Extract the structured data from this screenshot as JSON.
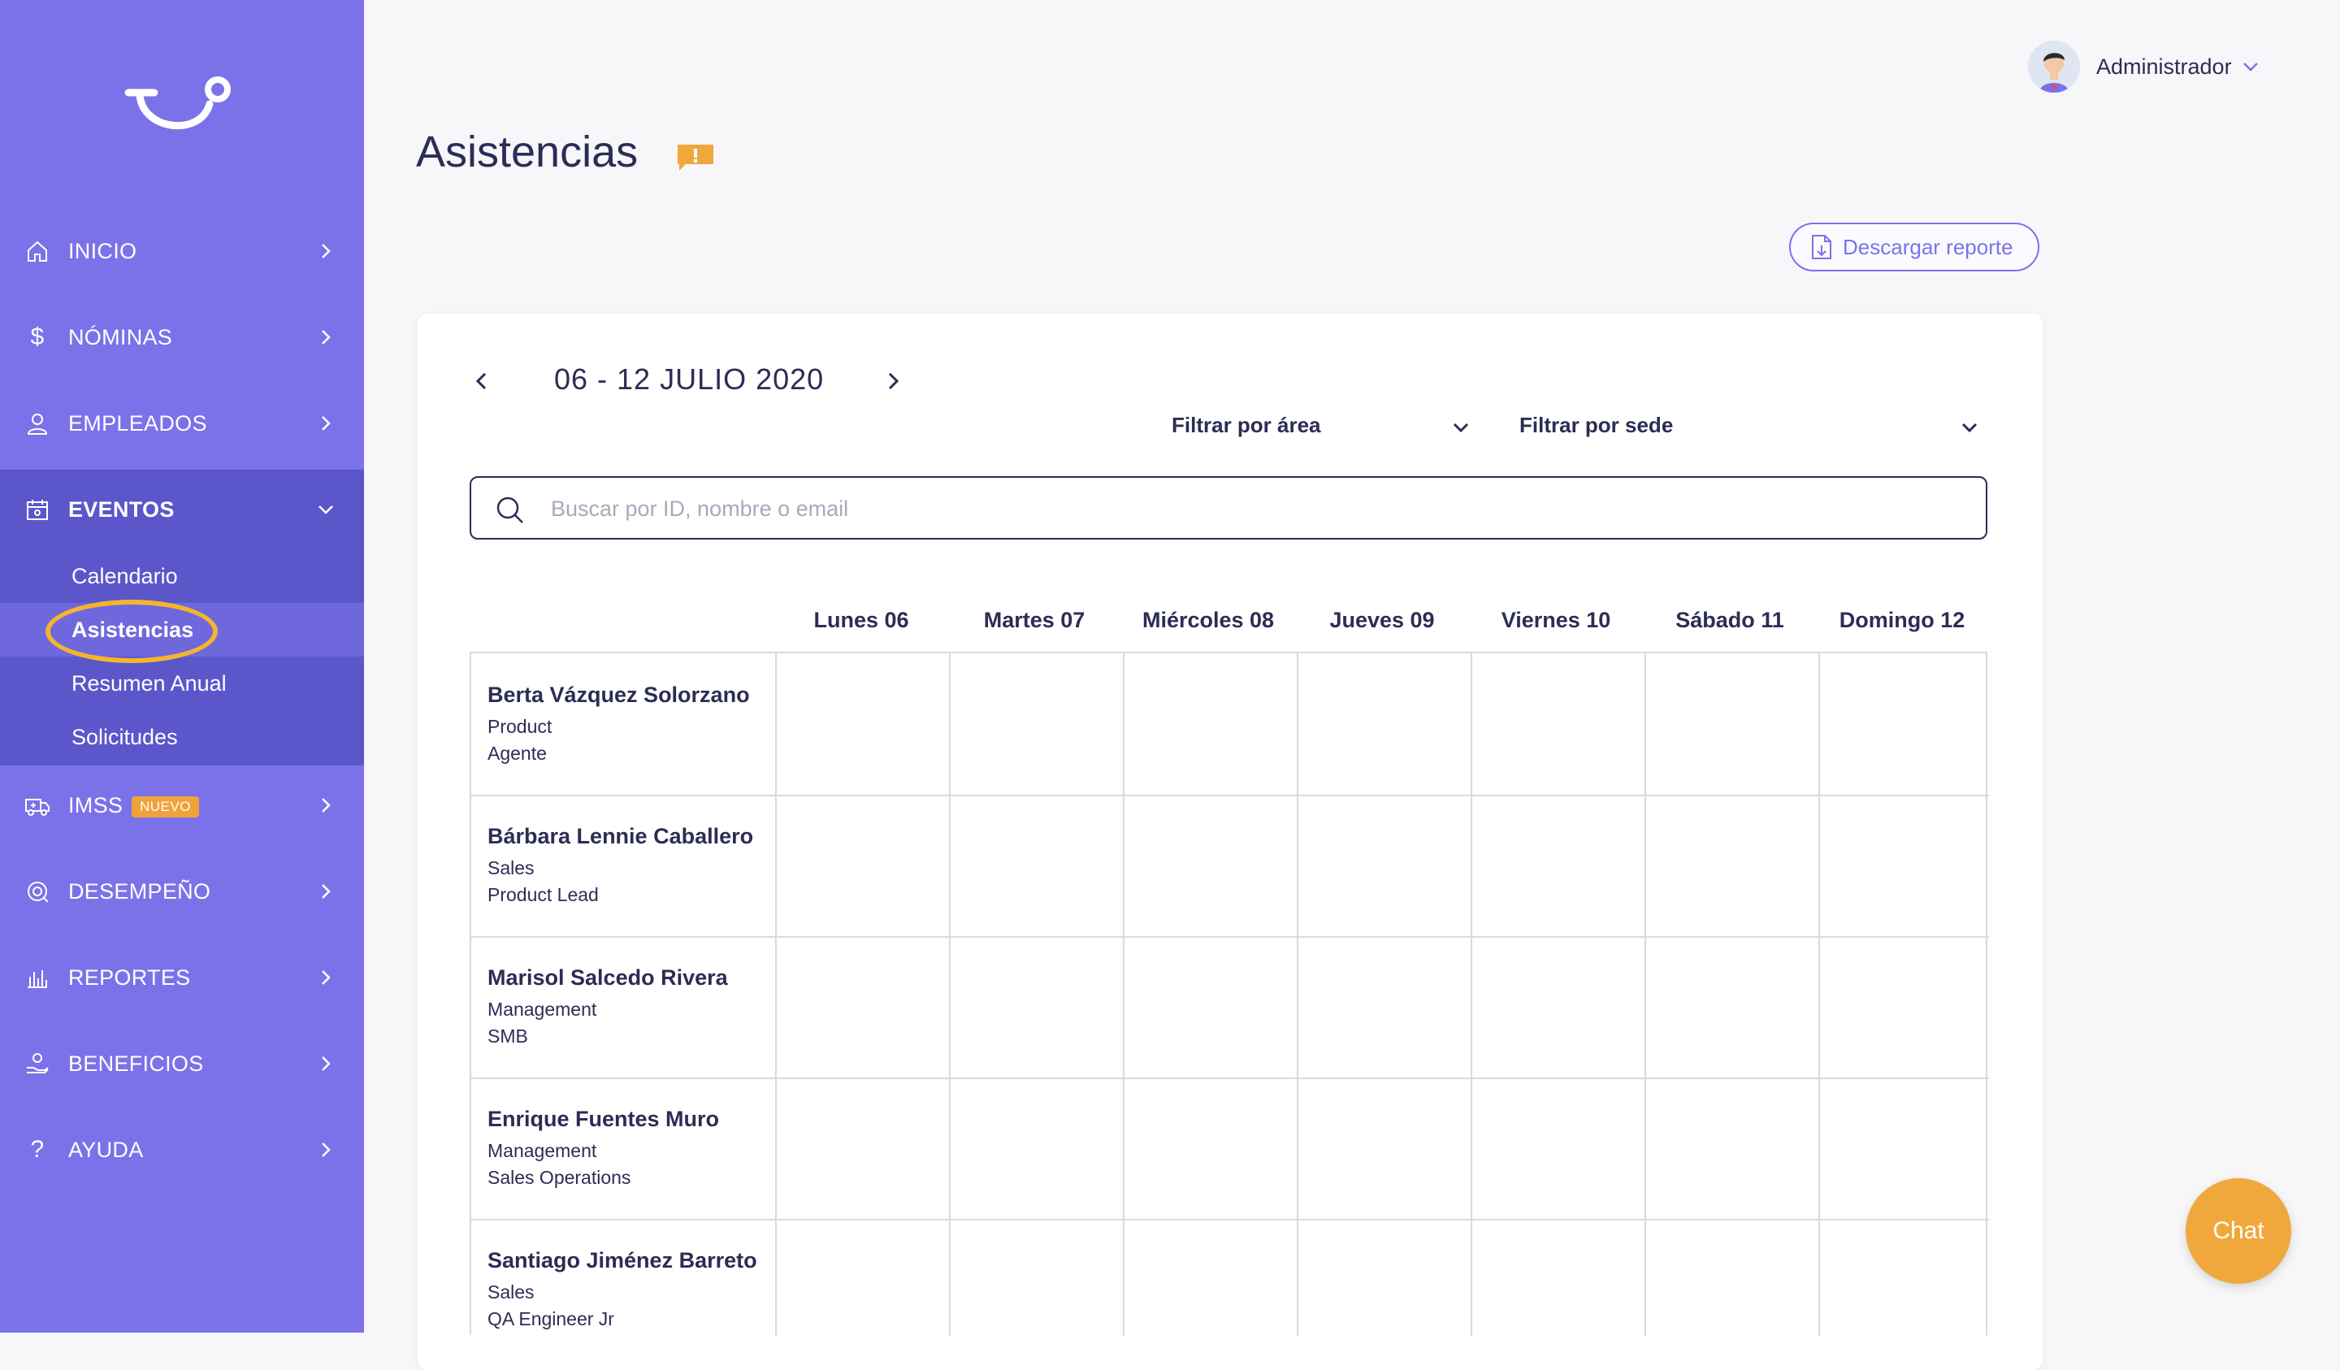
{
  "sidebar": {
    "items": [
      {
        "label": "INICIO"
      },
      {
        "label": "NÓMINAS"
      },
      {
        "label": "EMPLEADOS"
      },
      {
        "label": "EVENTOS"
      },
      {
        "label": "IMSS",
        "badge": "NUEVO"
      },
      {
        "label": "DESEMPEÑO"
      },
      {
        "label": "REPORTES"
      },
      {
        "label": "BENEFICIOS"
      },
      {
        "label": "AYUDA"
      }
    ],
    "events_sub": [
      {
        "label": "Calendario"
      },
      {
        "label": "Asistencias"
      },
      {
        "label": "Resumen Anual"
      },
      {
        "label": "Solicitudes"
      }
    ]
  },
  "header": {
    "user_name": "Administrador",
    "page_title": "Asistencias",
    "download_label": "Descargar reporte"
  },
  "week": {
    "label": "06 - 12 JULIO 2020"
  },
  "filters": {
    "area": "Filtrar por área",
    "sede": "Filtrar por sede"
  },
  "search": {
    "placeholder": "Buscar por ID, nombre o email"
  },
  "days": [
    "Lunes 06",
    "Martes 07",
    "Miércoles 08",
    "Jueves 09",
    "Viernes 10",
    "Sábado 11",
    "Domingo 12"
  ],
  "employees": [
    {
      "name": "Berta Vázquez Solorzano",
      "area": "Product",
      "role": "Agente"
    },
    {
      "name": "Bárbara Lennie Caballero",
      "area": "Sales",
      "role": "Product Lead"
    },
    {
      "name": "Marisol Salcedo Rivera",
      "area": "Management",
      "role": "SMB"
    },
    {
      "name": "Enrique Fuentes Muro",
      "area": "Management",
      "role": "Sales Operations"
    },
    {
      "name": "Santiago Jiménez Barreto",
      "area": "Sales",
      "role": "QA Engineer Jr"
    }
  ],
  "chat": {
    "label": "Chat"
  },
  "colors": {
    "sidebar": "#7b72e9",
    "sidebar_active": "#5c56cb",
    "accent": "#f0a83c",
    "text": "#2c2d55"
  }
}
